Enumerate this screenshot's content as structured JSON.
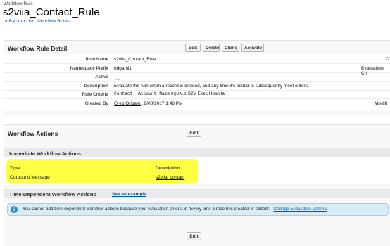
{
  "header": {
    "eyebrow": "Workflow Rule",
    "title": "s2viia_Contact_Rule",
    "back_link": "« Back to List: Workflow Rules"
  },
  "detail": {
    "section_title": "Workflow Rule Detail",
    "buttons": [
      "Edit",
      "Delete",
      "Clone",
      "Activate"
    ],
    "fields": [
      {
        "label": "Rule Name",
        "value": "s2viia_Contact_Rule"
      },
      {
        "label": "Namespace Prefix",
        "value": "origami1"
      },
      {
        "label": "Active",
        "value": ""
      },
      {
        "label": "Description",
        "value": "Evaluate the rule when a record is created, and any time it's edited to subsequently meet criteria"
      },
      {
        "label": "Rule Criteria",
        "value_field": "Contact: Account Name",
        "value_op": "EQUALS",
        "value_target": "S2V Exec Hospital"
      },
      {
        "label": "Created By",
        "value_link": "Greg Origami",
        "value_rest": ", 9/03/2017 1:48 PM"
      }
    ],
    "right_labels": [
      "O",
      "Evaluation Cri",
      "Modifi"
    ]
  },
  "actions": {
    "section_title": "Workflow Actions",
    "edit_label": "Edit",
    "immediate_title": "Immediate Workflow Actions",
    "col_type": "Type",
    "col_description": "Description",
    "row_type": "Outbound Message",
    "row_description": "s2viia_contact",
    "time_dependent_title": "Time-Dependent Workflow Actions",
    "see_example": "See an example",
    "info_message": "You cannot add time-dependent workflow actions because your evaluation criteria is \"Every time a record is created or edited\".",
    "change_link": "Change Evaluation Criteria",
    "bottom_edit_label": "Edit"
  },
  "colors": {
    "highlight": "#ffff3a",
    "link": "#015ba7",
    "section_bg": "#f3f3f3",
    "info_bg": "#d8ecf7"
  }
}
